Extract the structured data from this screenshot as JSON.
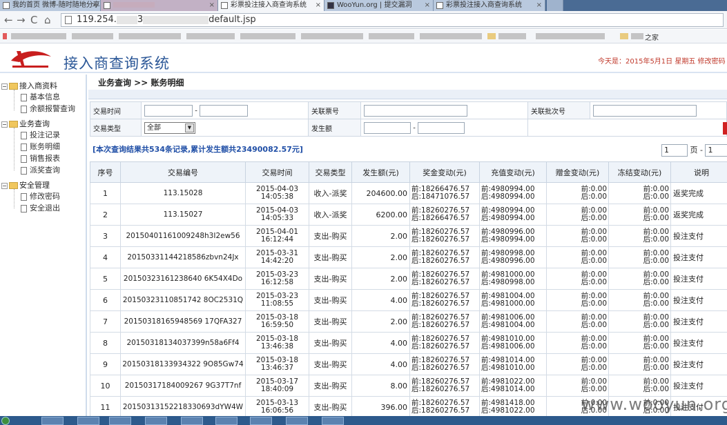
{
  "browser": {
    "tabs": [
      {
        "label": "我的首页 微博-随时随地分享…",
        "active": false
      },
      {
        "label": "",
        "active": false
      },
      {
        "label": "彩票投注接入商查询系统",
        "active": true
      },
      {
        "label": "WooYun.org | 提交漏洞",
        "active": false
      },
      {
        "label": "彩票投注接入商查询系统",
        "active": false
      }
    ],
    "url_prefix": "119.254.",
    "url_mid": "3",
    "url_suffix": "default.jsp",
    "bookmark_folder": "之家"
  },
  "header": {
    "title": "接入商查询系统",
    "date_text": "今天是：2015年5月1日   星期五   修改密码"
  },
  "sidebar": {
    "groups": [
      {
        "label": "接入商资料",
        "items": [
          "基本信息",
          "余额报警查询"
        ]
      },
      {
        "label": "业务查询",
        "items": [
          "投注记录",
          "账务明细",
          "销售报表",
          "派奖查询"
        ]
      },
      {
        "label": "安全管理",
        "items": [
          "修改密码",
          "安全退出"
        ]
      }
    ]
  },
  "main": {
    "breadcrumb": "业务查询 >> 账务明细",
    "filters": {
      "trade_time_label": "交易时间",
      "trade_time_sep": "-",
      "ticket_label": "关联票号",
      "batch_label": "关联批次号",
      "trade_type_label": "交易类型",
      "trade_type_value": "全部",
      "amount_label": "发生额",
      "amount_sep": "-"
    },
    "summary": "[本次查询结果共534条记录,累计发生额共23490082.57元]",
    "pager": {
      "page_value": "1",
      "page_text": "页 -",
      "total_value": "1"
    },
    "columns": [
      "序号",
      "交易编号",
      "交易时间",
      "交易类型",
      "发生额(元)",
      "奖金变动(元)",
      "充值变动(元)",
      "赠金变动(元)",
      "冻结变动(元)",
      "说明"
    ],
    "rows": [
      {
        "no": "1",
        "id": "113.15028",
        "date": "2015-04-03",
        "time": "14:05:38",
        "type": "收入-派奖",
        "amount": "204600.00",
        "bonus_before": "前:18266476.57",
        "bonus_after": "后:18471076.57",
        "charge_before": "前:4980994.00",
        "charge_after": "后:4980994.00",
        "gift_before": "前:0.00",
        "gift_after": "后:0.00",
        "frozen_before": "前:0.00",
        "frozen_after": "后:0.00",
        "note": "返奖完成"
      },
      {
        "no": "2",
        "id": "113.15027",
        "date": "2015-04-03",
        "time": "14:05:33",
        "type": "收入-派奖",
        "amount": "6200.00",
        "bonus_before": "前:18260276.57",
        "bonus_after": "后:18266476.57",
        "charge_before": "前:4980994.00",
        "charge_after": "后:4980994.00",
        "gift_before": "前:0.00",
        "gift_after": "后:0.00",
        "frozen_before": "前:0.00",
        "frozen_after": "后:0.00",
        "note": "返奖完成"
      },
      {
        "no": "3",
        "id": "20150401161009248h3I2ew56",
        "date": "2015-04-01",
        "time": "16:12:44",
        "type": "支出-购买",
        "amount": "2.00",
        "bonus_before": "前:18260276.57",
        "bonus_after": "后:18260276.57",
        "charge_before": "前:4980996.00",
        "charge_after": "后:4980994.00",
        "gift_before": "前:0.00",
        "gift_after": "后:0.00",
        "frozen_before": "前:0.00",
        "frozen_after": "后:0.00",
        "note": "投注支付"
      },
      {
        "no": "4",
        "id": "20150331144218586zbvn24Jx",
        "date": "2015-03-31",
        "time": "14:42:20",
        "type": "支出-购买",
        "amount": "2.00",
        "bonus_before": "前:18260276.57",
        "bonus_after": "后:18260276.57",
        "charge_before": "前:4980998.00",
        "charge_after": "后:4980996.00",
        "gift_before": "前:0.00",
        "gift_after": "后:0.00",
        "frozen_before": "前:0.00",
        "frozen_after": "后:0.00",
        "note": "投注支付"
      },
      {
        "no": "5",
        "id": "20150323161238640 6K54X4Do",
        "date": "2015-03-23",
        "time": "16:12:58",
        "type": "支出-购买",
        "amount": "2.00",
        "bonus_before": "前:18260276.57",
        "bonus_after": "后:18260276.57",
        "charge_before": "前:4981000.00",
        "charge_after": "后:4980998.00",
        "gift_before": "前:0.00",
        "gift_after": "后:0.00",
        "frozen_before": "前:0.00",
        "frozen_after": "后:0.00",
        "note": "投注支付"
      },
      {
        "no": "6",
        "id": "20150323110851742 8OC2531Q",
        "date": "2015-03-23",
        "time": "11:08:55",
        "type": "支出-购买",
        "amount": "4.00",
        "bonus_before": "前:18260276.57",
        "bonus_after": "后:18260276.57",
        "charge_before": "前:4981004.00",
        "charge_after": "后:4981000.00",
        "gift_before": "前:0.00",
        "gift_after": "后:0.00",
        "frozen_before": "前:0.00",
        "frozen_after": "后:0.00",
        "note": "投注支付"
      },
      {
        "no": "7",
        "id": "20150318165948569 17QFA327",
        "date": "2015-03-18",
        "time": "16:59:50",
        "type": "支出-购买",
        "amount": "2.00",
        "bonus_before": "前:18260276.57",
        "bonus_after": "后:18260276.57",
        "charge_before": "前:4981006.00",
        "charge_after": "后:4981004.00",
        "gift_before": "前:0.00",
        "gift_after": "后:0.00",
        "frozen_before": "前:0.00",
        "frozen_after": "后:0.00",
        "note": "投注支付"
      },
      {
        "no": "8",
        "id": "20150318134037399n58a6Ff4",
        "date": "2015-03-18",
        "time": "13:46:38",
        "type": "支出-购买",
        "amount": "4.00",
        "bonus_before": "前:18260276.57",
        "bonus_after": "后:18260276.57",
        "charge_before": "前:4981010.00",
        "charge_after": "后:4981006.00",
        "gift_before": "前:0.00",
        "gift_after": "后:0.00",
        "frozen_before": "前:0.00",
        "frozen_after": "后:0.00",
        "note": "投注支付"
      },
      {
        "no": "9",
        "id": "20150318133934322 9O85Gw74",
        "date": "2015-03-18",
        "time": "13:46:37",
        "type": "支出-购买",
        "amount": "4.00",
        "bonus_before": "前:18260276.57",
        "bonus_after": "后:18260276.57",
        "charge_before": "前:4981014.00",
        "charge_after": "后:4981010.00",
        "gift_before": "前:0.00",
        "gift_after": "后:0.00",
        "frozen_before": "前:0.00",
        "frozen_after": "后:0.00",
        "note": "投注支付"
      },
      {
        "no": "10",
        "id": "20150317184009267 9G37T7nf",
        "date": "2015-03-17",
        "time": "18:40:09",
        "type": "支出-购买",
        "amount": "8.00",
        "bonus_before": "前:18260276.57",
        "bonus_after": "后:18260276.57",
        "charge_before": "前:4981022.00",
        "charge_after": "后:4981014.00",
        "gift_before": "前:0.00",
        "gift_after": "后:0.00",
        "frozen_before": "前:0.00",
        "frozen_after": "后:0.00",
        "note": "投注支付"
      },
      {
        "no": "11",
        "id": "20150313152218330693dYW4W",
        "date": "2015-03-13",
        "time": "16:06:56",
        "type": "支出-购买",
        "amount": "396.00",
        "bonus_before": "前:18260276.57",
        "bonus_after": "后:18260276.57",
        "charge_before": "前:4981418.00",
        "charge_after": "后:4981022.00",
        "gift_before": "前:0.00",
        "gift_after": "后:0.00",
        "frozen_before": "前:0.00",
        "frozen_after": "后:0.00",
        "note": "投注支付"
      }
    ]
  },
  "watermark": "www.wooyun.org",
  "colors": {
    "accent": "#2b5797",
    "summary": "#1f4ea6",
    "date": "#c0392b"
  }
}
